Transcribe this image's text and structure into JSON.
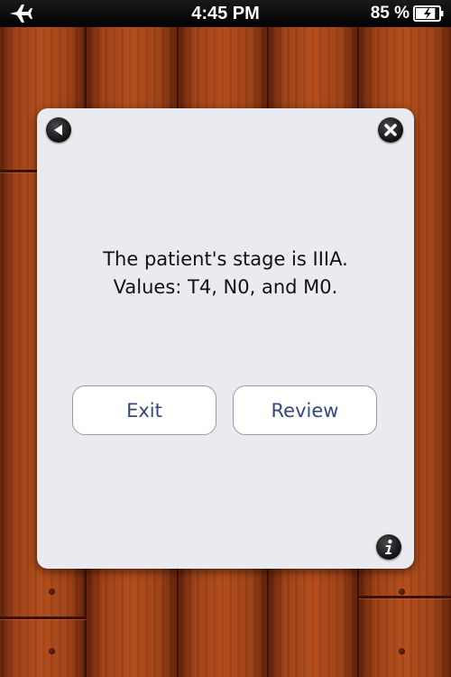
{
  "status_bar": {
    "time": "4:45 PM",
    "battery_percent": "85 %",
    "battery_level": 0.85,
    "icons": [
      "airplane-icon",
      "battery-icon"
    ]
  },
  "dialog": {
    "message_line1": "The patient's stage is IIIA.",
    "message_line2": "Values: T4, N0, and M0.",
    "exit_label": "Exit",
    "review_label": "Review",
    "icons": [
      "back-icon",
      "close-icon",
      "info-icon"
    ]
  },
  "colors": {
    "dialog_background": "#eaeaf1",
    "button_text": "#34487a",
    "wood": "#9a4117"
  }
}
